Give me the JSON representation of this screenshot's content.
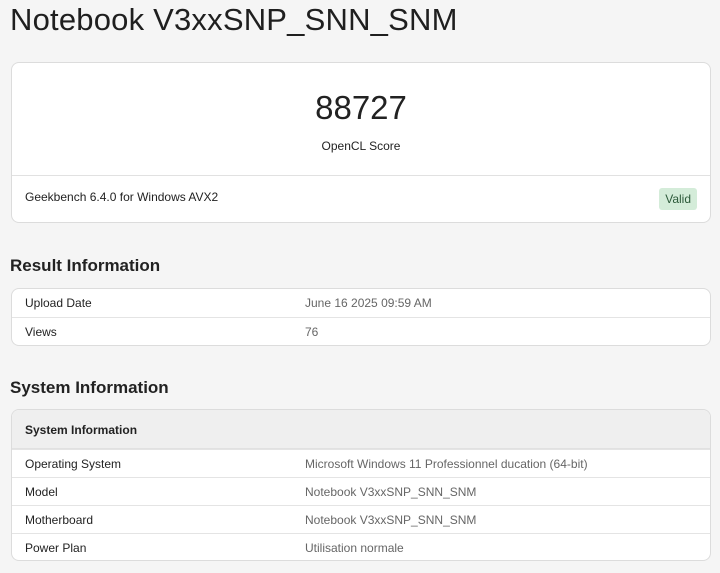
{
  "page": {
    "title": "Notebook V3xxSNP_SNN_SNM"
  },
  "score_card": {
    "score": "88727",
    "score_label": "OpenCL Score",
    "version": "Geekbench 6.4.0 for Windows AVX2",
    "status_badge": "Valid"
  },
  "result_information": {
    "heading": "Result Information",
    "rows": [
      {
        "label": "Upload Date",
        "value": "June 16 2025 09:59 AM"
      },
      {
        "label": "Views",
        "value": "76"
      }
    ]
  },
  "system_information": {
    "heading": "System Information",
    "table_header": "System Information",
    "rows": [
      {
        "label": "Operating System",
        "value": "Microsoft Windows 11 Professionnel ducation (64-bit)"
      },
      {
        "label": "Model",
        "value": "Notebook V3xxSNP_SNN_SNM"
      },
      {
        "label": "Motherboard",
        "value": "Notebook V3xxSNP_SNN_SNM"
      },
      {
        "label": "Power Plan",
        "value": "Utilisation normale"
      }
    ]
  },
  "colors": {
    "valid_badge_bg": "#d4ecd9",
    "valid_badge_text": "#2d5a3a",
    "page_background": "#f5f5f5"
  }
}
